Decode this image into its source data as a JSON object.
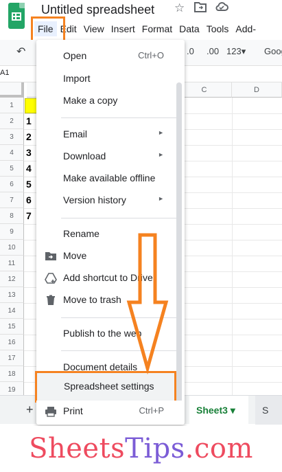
{
  "app": {
    "doc_title": "Untitled spreadsheet",
    "menus": [
      "File",
      "Edit",
      "View",
      "Insert",
      "Format",
      "Data",
      "Tools",
      "Add-"
    ]
  },
  "toolbar": {
    "decimal_less": ".0",
    "decimal_more": ".00",
    "number_format": "123▾",
    "font_name": "Goog"
  },
  "formula": {
    "cell_ref": "A1"
  },
  "grid": {
    "columns": [
      "C",
      "D"
    ],
    "rows": [
      "1",
      "2",
      "3",
      "4",
      "5",
      "6",
      "7",
      "8",
      "9",
      "10",
      "11",
      "12",
      "13",
      "14",
      "15",
      "16",
      "17",
      "18",
      "19"
    ],
    "values": [
      "1",
      "2",
      "3",
      "4",
      "5",
      "6",
      "7"
    ]
  },
  "file_menu": {
    "items": [
      {
        "label": "Open",
        "shortcut": "Ctrl+O"
      },
      {
        "label": "Import"
      },
      {
        "label": "Make a copy"
      },
      {
        "label": "Email",
        "arrow": "►"
      },
      {
        "label": "Download",
        "arrow": "►"
      },
      {
        "label": "Make available offline"
      },
      {
        "label": "Version history",
        "arrow": "►"
      },
      {
        "label": "Rename"
      },
      {
        "label": "Move"
      },
      {
        "label": "Add shortcut to Drive"
      },
      {
        "label": "Move to trash"
      },
      {
        "label": "Publish to the web"
      },
      {
        "label": "Document details"
      },
      {
        "label": "Spreadsheet settings"
      },
      {
        "label": "Print",
        "shortcut": "Ctrl+P"
      }
    ]
  },
  "sheets": {
    "active": "Sheet3 ▾",
    "next": "S"
  },
  "add_sheet": "+",
  "brand": {
    "part1": "Sheets",
    "part2": "Tips",
    "part3": ".com"
  },
  "colors": {
    "highlight": "#f58220",
    "sheets_green": "#23a566",
    "brand_red": "#ee4b5f",
    "brand_purple": "#7b5cd6"
  }
}
